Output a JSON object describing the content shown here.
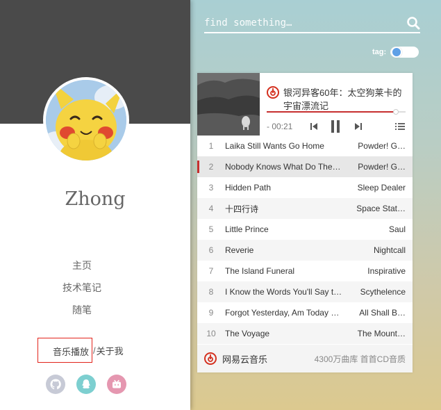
{
  "sidebar": {
    "site_name": "Zhong",
    "nav": [
      "主页",
      "技术笔记",
      "随笔"
    ],
    "music_link": "音乐播放",
    "separator": "/",
    "about_link": "关于我",
    "social": [
      {
        "icon": "github-icon",
        "color": "#c7cad6"
      },
      {
        "icon": "qq-icon",
        "color": "#7dcfd0"
      },
      {
        "icon": "bilibili-icon",
        "color": "#e597b0"
      }
    ]
  },
  "search": {
    "placeholder": "find something…"
  },
  "tag_toggle": {
    "label": "tag:",
    "enabled": false
  },
  "player": {
    "now_playing": "银河异客60年：太空狗莱卡的宇宙漂流记",
    "time": "- 00:21",
    "progress": 0.93,
    "accent": "#c62f2f",
    "tracks": [
      {
        "num": "1",
        "name": "Laika Still Wants Go Home",
        "artist": "Powder! G…"
      },
      {
        "num": "2",
        "name": "Nobody Knows What Do The…",
        "artist": "Powder! G…"
      },
      {
        "num": "3",
        "name": "Hidden Path",
        "artist": "Sleep Dealer"
      },
      {
        "num": "4",
        "name": "十四行诗",
        "artist": "Space Stat…"
      },
      {
        "num": "5",
        "name": "Little Prince",
        "artist": "Saul"
      },
      {
        "num": "6",
        "name": "Reverie",
        "artist": "Nightcall"
      },
      {
        "num": "7",
        "name": "The Island Funeral",
        "artist": "Inspirative"
      },
      {
        "num": "8",
        "name": "I Know the Words You'll Say t…",
        "artist": "Scythelence"
      },
      {
        "num": "9",
        "name": "Forgot Yesterday, Am Today …",
        "artist": "All Shall B…"
      },
      {
        "num": "10",
        "name": "The Voyage",
        "artist": "The Mount…"
      }
    ],
    "current_track": 2,
    "brand": "网易云音乐",
    "brand_tagline": "4300万曲库 首首CD音质"
  }
}
